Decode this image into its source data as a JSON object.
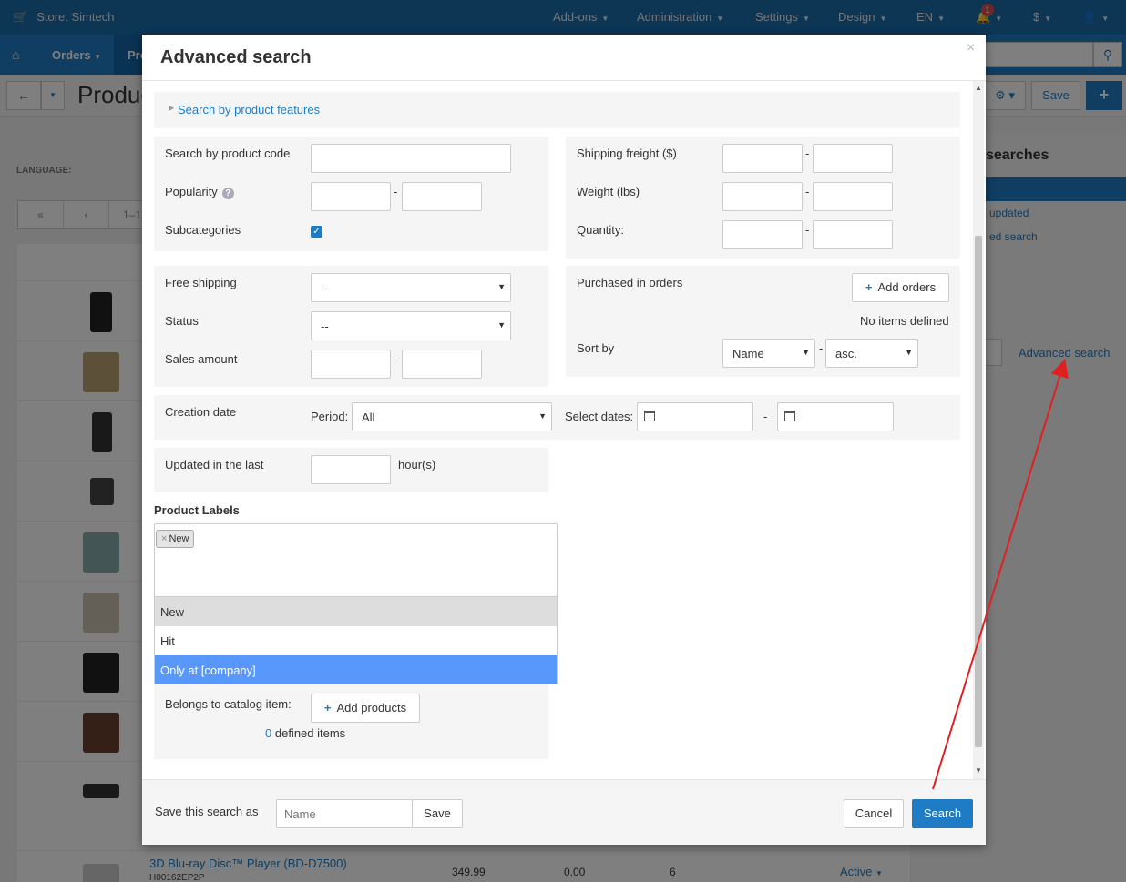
{
  "topbar": {
    "store": "Store: Simtech",
    "menus": [
      "Add-ons",
      "Administration",
      "Settings",
      "Design",
      "EN"
    ],
    "notifications": "1",
    "currency": "$"
  },
  "navbar": {
    "orders": "Orders",
    "products": "Pro"
  },
  "subbar": {
    "title": "Produc",
    "save": "Save"
  },
  "page": {
    "language_label": "LANGUAGE:",
    "pager": [
      "«",
      "‹",
      "1–1"
    ],
    "saved_searches_title": "searches",
    "saved_link_updated": "updated",
    "saved_link_search": "ed search",
    "advanced_search_link": "Advanced search",
    "last_row": {
      "name": "3D Blu-ray Disc™ Player (BD-D7500)",
      "code": "H00162EP2P",
      "price": "349.99",
      "list_price": "0.00",
      "qty": "6",
      "status": "Active"
    }
  },
  "modal": {
    "title": "Advanced search",
    "close": "×",
    "features_link": "Search by product features",
    "product_code_label": "Search by product code",
    "popularity_label": "Popularity",
    "subcategories_label": "Subcategories",
    "shipping_freight_label": "Shipping freight ($)",
    "weight_label": "Weight (lbs)",
    "quantity_label": "Quantity:",
    "free_shipping_label": "Free shipping",
    "free_shipping_value": "--",
    "status_label": "Status",
    "status_value": "--",
    "sales_amount_label": "Sales amount",
    "purchased_label": "Purchased in orders",
    "add_orders": "Add orders",
    "no_items": "No items defined",
    "sort_by_label": "Sort by",
    "sort_field": "Name",
    "sort_dir": "asc.",
    "creation_date_label": "Creation date",
    "period_label": "Period:",
    "period_value": "All",
    "select_dates_label": "Select dates:",
    "updated_label": "Updated in the last",
    "hours_label": "hour(s)",
    "product_labels_title": "Product Labels",
    "selected_tag": "New",
    "dropdown_options": [
      "New",
      "Hit",
      "Only at [company]"
    ],
    "belongs_label": "Belongs to catalog item:",
    "add_products": "Add products",
    "defined_count": "0",
    "defined_items": "defined items"
  },
  "footer": {
    "save_search_label": "Save this search as",
    "name_placeholder": "Name",
    "save": "Save",
    "cancel": "Cancel",
    "search": "Search"
  },
  "colors": {
    "accent": "#1f7cc4",
    "topbar": "#1a6aa8",
    "annotation_arrow": "#e02020"
  }
}
